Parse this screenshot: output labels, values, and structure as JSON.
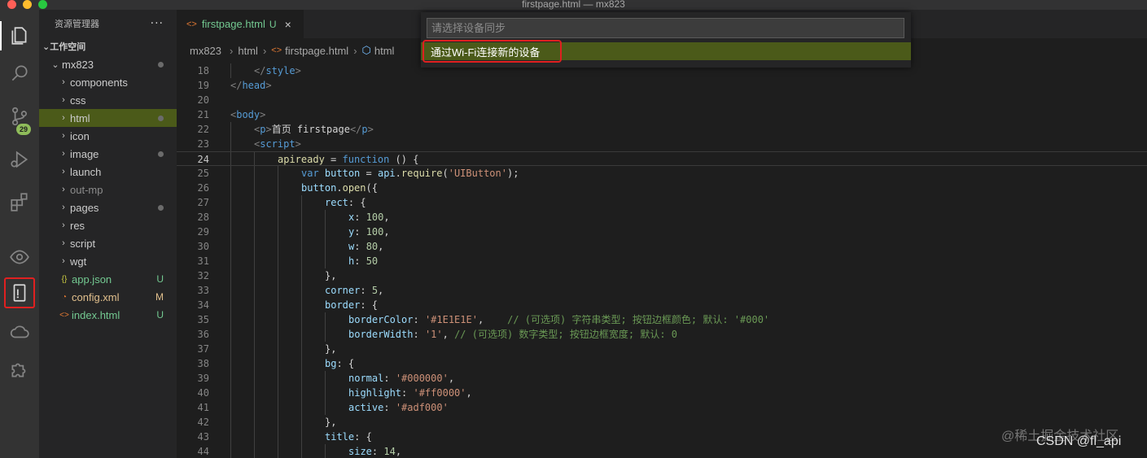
{
  "window": {
    "title": "firstpage.html — mx823"
  },
  "activity_bar": {
    "items": [
      "explorer-icon",
      "search-icon",
      "source-control-icon",
      "run-debug-icon",
      "extensions-icon",
      "eye-icon",
      "device-sync-icon",
      "cloud-icon",
      "puzzle-icon"
    ],
    "source_control_badge": "29"
  },
  "sidebar": {
    "title": "资源管理器",
    "more": "···",
    "section": "工作空间",
    "root": "mx823",
    "items": [
      {
        "label": "components",
        "type": "folder"
      },
      {
        "label": "css",
        "type": "folder"
      },
      {
        "label": "html",
        "type": "folder"
      },
      {
        "label": "icon",
        "type": "folder"
      },
      {
        "label": "image",
        "type": "folder"
      },
      {
        "label": "launch",
        "type": "folder"
      },
      {
        "label": "out-mp",
        "type": "folder"
      },
      {
        "label": "pages",
        "type": "folder"
      },
      {
        "label": "res",
        "type": "folder"
      },
      {
        "label": "script",
        "type": "folder"
      },
      {
        "label": "wgt",
        "type": "folder"
      },
      {
        "label": "app.json",
        "type": "file",
        "status": "U"
      },
      {
        "label": "config.xml",
        "type": "file",
        "status": "M"
      },
      {
        "label": "index.html",
        "type": "file",
        "status": "U"
      }
    ]
  },
  "tab": {
    "label": "firstpage.html",
    "status": "U",
    "close": "×"
  },
  "breadcrumb": {
    "parts": [
      "mx823",
      "html",
      "firstpage.html",
      "html"
    ]
  },
  "quick_pick": {
    "placeholder": "请选择设备同步",
    "item": "通过Wi-Fi连接新的设备"
  },
  "code": {
    "line_numbers": [
      "18",
      "19",
      "20",
      "21",
      "22",
      "23",
      "24",
      "25",
      "26",
      "27",
      "28",
      "29",
      "30",
      "31",
      "32",
      "33",
      "34",
      "35",
      "36",
      "37",
      "38",
      "39",
      "40",
      "41",
      "42",
      "43",
      "44"
    ]
  },
  "watermark": "@稀土掘金技术社区",
  "watermark2": "CSDN @fl_api"
}
